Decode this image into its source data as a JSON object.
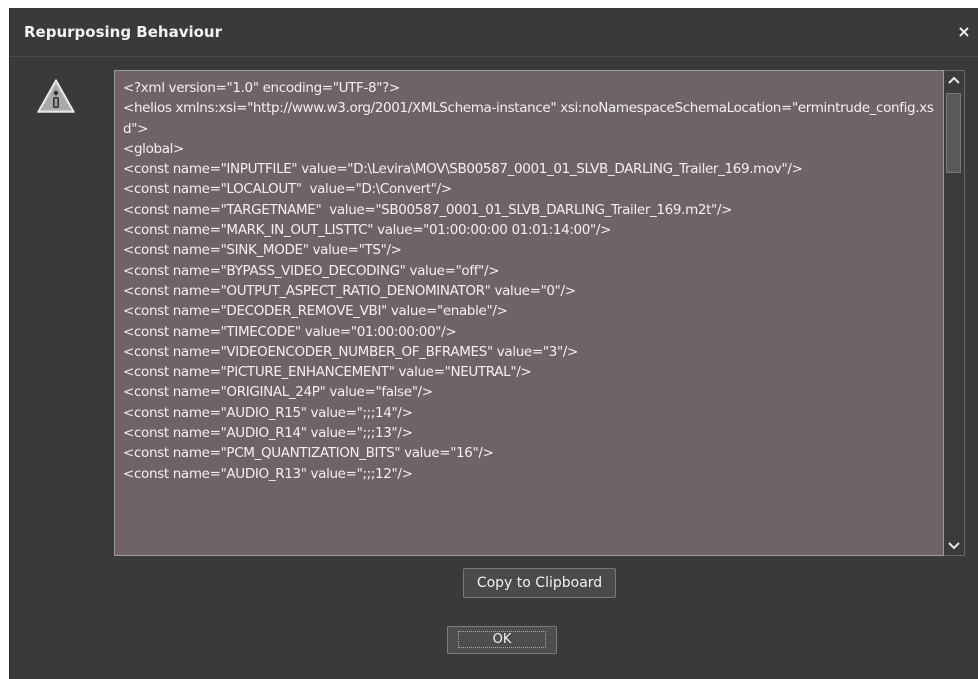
{
  "dialog": {
    "title": "Repurposing Behaviour",
    "close_glyph": "×",
    "icon": "warning-icon"
  },
  "xml_text": "<?xml version=\"1.0\" encoding=\"UTF-8\"?>\n<helios xmlns:xsi=\"http://www.w3.org/2001/XMLSchema-instance\" xsi:noNamespaceSchemaLocation=\"ermintrude_config.xsd\">\n<global>\n<const name=\"INPUTFILE\" value=\"D:\\Levira\\MOV\\SB00587_0001_01_SLVB_DARLING_Trailer_169.mov\"/>\n<const name=\"LOCALOUT\"  value=\"D:\\Convert\"/>\n<const name=\"TARGETNAME\"  value=\"SB00587_0001_01_SLVB_DARLING_Trailer_169.m2t\"/>\n<const name=\"MARK_IN_OUT_LISTTC\" value=\"01:00:00:00 01:01:14:00\"/>\n<const name=\"SINK_MODE\" value=\"TS\"/>\n<const name=\"BYPASS_VIDEO_DECODING\" value=\"off\"/>\n<const name=\"OUTPUT_ASPECT_RATIO_DENOMINATOR\" value=\"0\"/>\n<const name=\"DECODER_REMOVE_VBI\" value=\"enable\"/>\n<const name=\"TIMECODE\" value=\"01:00:00:00\"/>\n<const name=\"VIDEOENCODER_NUMBER_OF_BFRAMES\" value=\"3\"/>\n<const name=\"PICTURE_ENHANCEMENT\" value=\"NEUTRAL\"/>\n<const name=\"ORIGINAL_24P\" value=\"false\"/>\n<const name=\"AUDIO_R15\" value=\";;;14\"/>\n<const name=\"AUDIO_R14\" value=\";;;13\"/>\n<const name=\"PCM_QUANTIZATION_BITS\" value=\"16\"/>\n<const name=\"AUDIO_R13\" value=\";;;12\"/>",
  "scrollbar": {
    "up_glyph": "⌃",
    "down_glyph": "⌄"
  },
  "buttons": {
    "copy_label": "Copy to Clipboard",
    "ok_label": "OK"
  },
  "colors": {
    "dialog_bg": "#3a3a3a",
    "textarea_bg": "#6f6269",
    "text": "#f4f0f2"
  }
}
